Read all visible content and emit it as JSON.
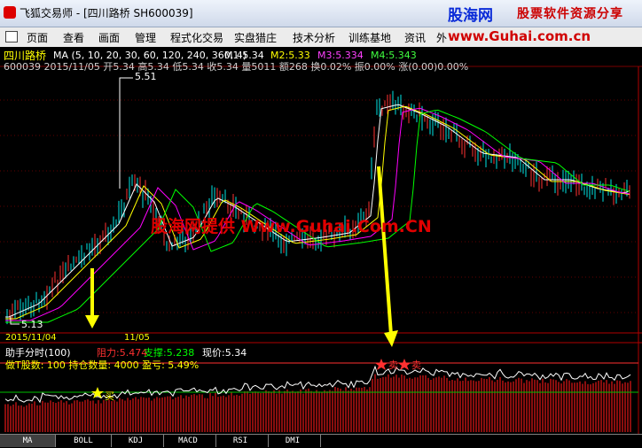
{
  "window": {
    "title": "飞狐交易师 - [四川路桥  SH600039]",
    "brand": "股海网",
    "brand_sub": "股票软件资源分享",
    "url_banner": "www.Guhai.com.cn"
  },
  "menu": [
    "页面",
    "查看",
    "画面",
    "管理",
    "程式化交易",
    "实盘猎庄",
    "技术分析",
    "训练基地",
    "资讯",
    "外"
  ],
  "header": {
    "stock_name": "四川路桥",
    "ma_label": "MA (5, 10, 20, 30, 60, 120, 240, 360, 4)",
    "m1": "M1:5.34",
    "m2": "M2:5.33",
    "m3": "M3:5.334",
    "m4": "M4:5.343",
    "quote": "600039  2015/11/05 开5.34 高5.34 低5.34 收5.34 量5011 额268 换0.02% 振0.00% 涨(0.00)0.00%"
  },
  "main_chart": {
    "high_label": "5.51",
    "low_label": "5.13",
    "watermark": "股海网提供 Www.Guhai.Com.CN",
    "date_left": "2015/11/04",
    "date_mid": "11/05"
  },
  "sub_chart": {
    "title": "助手分时(100)",
    "resistance": "阻力:5.474",
    "support": "支撑:5.238",
    "price": "现价:5.34",
    "info_line": "做T股数: 100   持仓数量: 4000   盈亏: 5.49%",
    "buy": "买",
    "sell": "卖"
  },
  "tabs": [
    "MA",
    "BOLL",
    "KDJ",
    "MACD",
    "RSI",
    "DMI"
  ],
  "colors": {
    "up": "#ff3232",
    "down": "#00e5e5",
    "ma1": "#ffffff",
    "ma2": "#ffff00",
    "ma3": "#ff00ff",
    "ma4": "#00ff00",
    "arrow": "#ffff00"
  }
}
